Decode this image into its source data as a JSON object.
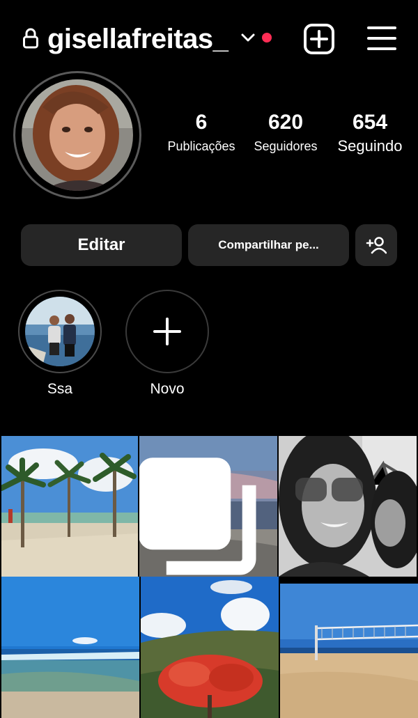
{
  "header": {
    "username": "gisellafreitas_",
    "icons": [
      "lock-icon",
      "chevron-down-icon",
      "notification-dot",
      "new-post-icon",
      "menu-icon"
    ],
    "notification_color": "#ff2d55"
  },
  "profile": {
    "stats": [
      {
        "value": "6",
        "label": "Publicações"
      },
      {
        "value": "620",
        "label": "Seguidores"
      },
      {
        "value": "654",
        "label": "Seguindo"
      }
    ]
  },
  "actions": {
    "edit_label": "Editar",
    "share_label": "Compartilhar pe...",
    "add_person_icon": "add-person-icon"
  },
  "highlights": [
    {
      "label": "Ssa"
    },
    {
      "label": "Novo"
    }
  ],
  "grid": {
    "posts": [
      {
        "name": "post-palm-beach"
      },
      {
        "name": "post-sunset",
        "multiple": true
      },
      {
        "name": "post-selfie-bw"
      },
      {
        "name": "post-blue-sea"
      },
      {
        "name": "post-red-tree"
      },
      {
        "name": "post-volleyball-net"
      }
    ]
  }
}
